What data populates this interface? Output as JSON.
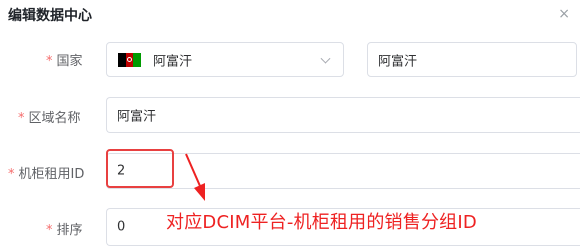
{
  "dialog": {
    "title": "编辑数据中心",
    "close_icon": "×"
  },
  "form": {
    "country": {
      "required_mark": "*",
      "label": "国家",
      "flag_icon": "afghanistan-flag-icon",
      "selected": "阿富汗",
      "text_value": "阿富汗"
    },
    "region_name": {
      "required_mark": "*",
      "label": "区域名称",
      "value": "阿富汗"
    },
    "cabinet_rental_id": {
      "required_mark": "*",
      "label": "机柜租用ID",
      "value": "2"
    },
    "sort": {
      "required_mark": "*",
      "label": "排序",
      "value": "0"
    }
  },
  "annotation": {
    "text": "对应DCIM平台-机柜租用的销售分组ID",
    "color": "#ee2222"
  },
  "colors": {
    "required": "#f56c6c",
    "border": "#dcdfe6",
    "highlight": "#e84040"
  }
}
